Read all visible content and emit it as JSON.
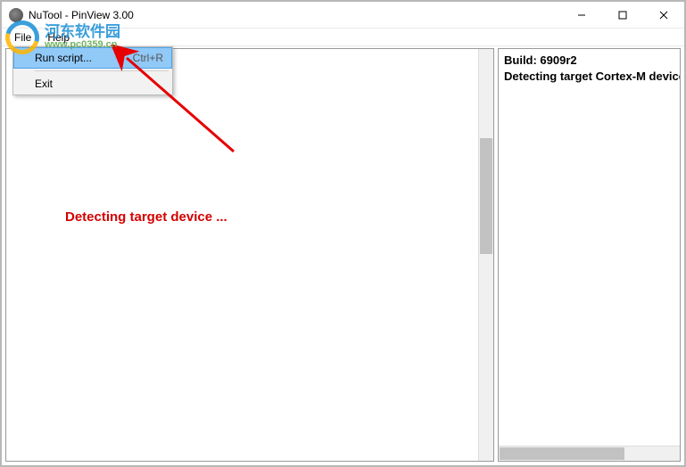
{
  "window": {
    "title": "NuTool - PinView 3.00"
  },
  "menubar": {
    "file": "File",
    "help": "Help"
  },
  "dropdown": {
    "run_label": "Run script...",
    "run_shortcut": "Ctrl+R",
    "exit_label": "Exit"
  },
  "main": {
    "status_text": "Detecting target device ..."
  },
  "log": {
    "line1": "Build: 6909r2",
    "line2": "Detecting target Cortex-M device"
  },
  "watermark": {
    "title": "河东软件园",
    "url": "www.pc0359.cn"
  }
}
